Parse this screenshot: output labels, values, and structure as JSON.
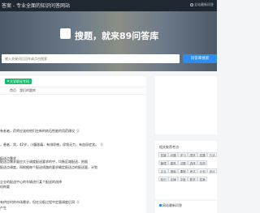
{
  "header": {
    "site_name": "答案 - 专业全面的知识问答网站",
    "top_link": "全站最新问答"
  },
  "hero": {
    "title": "搜题，就来89问答库",
    "search_placeholder": "输入关键词后回车或点击搜索",
    "search_button": "问答库搜索"
  },
  "main": {
    "badge": "大学职业专科",
    "tabs": [
      "首页",
      "我们的题库"
    ],
    "questions": [
      "有老者，药师应该给他们在新的结石性能的用药建议（）",
      "，患者，男，42岁，小腹胀痛，有排尿感，尿频无力，有血尿症状。（）",
      "配送点需求",
      "配送点需求量应大于调度配送要求的中，均衡区域配送，依据",
      "配送点调度，再根据每个配送线路的要求确定配送点的配送量，计划",
      "企业的配送中心的车辆进行某个配送的选择",
      "机构要",
      "有供应时的市场需求，但在分配过程中定量调度后同（）",
      "产生"
    ]
  },
  "sidebar": {
    "tags_title": "相关推荐考点",
    "tags": [
      "答疑",
      "问题",
      "学习",
      "国学",
      "答题",
      "方法",
      "管理",
      "建筑",
      "试题",
      "选择",
      "检测",
      "企业",
      "指南",
      "课程",
      "考试",
      "计划",
      "设计",
      "知识",
      "法律",
      "中医",
      "数学",
      "答案"
    ],
    "bottom_title": "网站最新问答"
  },
  "colors": {
    "topbar": "#1f2730",
    "accent": "#2d8cf0",
    "badge": "#19be6b"
  }
}
